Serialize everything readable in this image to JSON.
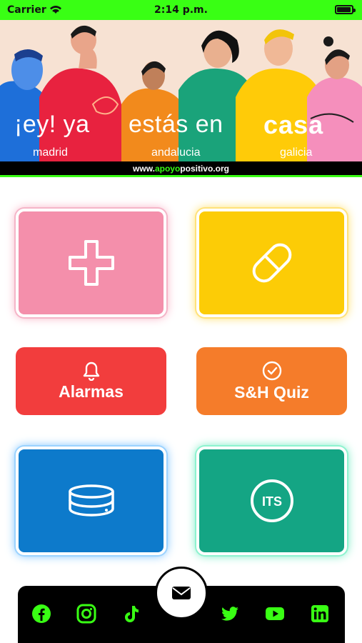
{
  "status_bar": {
    "carrier": "Carrier",
    "time": "2:14 p.m."
  },
  "banner": {
    "headline_1": "¡ey! ya",
    "headline_2": "estás en",
    "headline_3": "casa",
    "region_1": "madrid",
    "region_2": "andalucia",
    "region_3": "galicia",
    "url_prefix": "www.",
    "url_brand": "apoyo",
    "url_suffix": "positivo.org"
  },
  "tiles": {
    "medical": {
      "icon": "plus-icon",
      "color": "#f48fab"
    },
    "medication": {
      "icon": "pill-icon",
      "color": "#fccc06"
    },
    "alarms": {
      "label": "Alarmas",
      "icon": "bell-icon",
      "color": "#f23d3d"
    },
    "quiz": {
      "label": "S&H Quiz",
      "icon": "check-circle-icon",
      "color": "#f57c2a"
    },
    "storage": {
      "icon": "database-icon",
      "color": "#0d7acb"
    },
    "its": {
      "icon_text": "ITS",
      "color": "#14a584"
    }
  },
  "footer": {
    "accent": "#39ff14",
    "social": [
      "facebook-icon",
      "instagram-icon",
      "tiktok-icon",
      "twitter-icon",
      "youtube-icon",
      "linkedin-icon"
    ],
    "mail_icon": "mail-icon"
  }
}
